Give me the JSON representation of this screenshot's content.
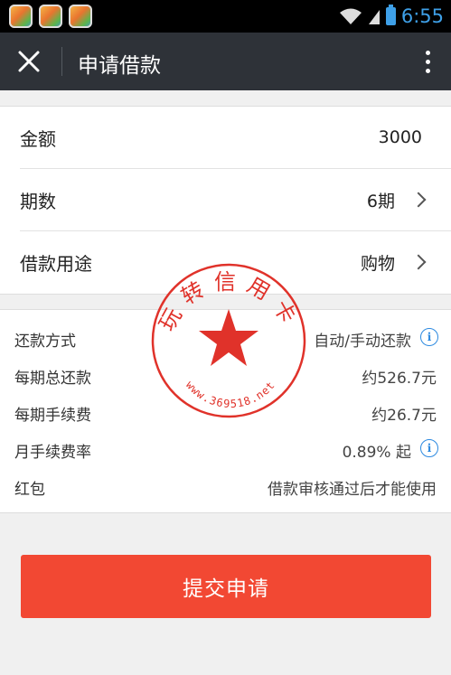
{
  "statusbar": {
    "time": "6:55"
  },
  "titlebar": {
    "title": "申请借款"
  },
  "form": {
    "amount": {
      "label": "金额",
      "value": "3000"
    },
    "periods": {
      "label": "期数",
      "value": "6期"
    },
    "purpose": {
      "label": "借款用途",
      "value": "购物"
    }
  },
  "details": [
    {
      "label": "还款方式",
      "value": "自动/手动还款"
    },
    {
      "label": "每期总还款",
      "value": "约526.7元"
    },
    {
      "label": "每期手续费",
      "value": "约26.7元"
    },
    {
      "label": "月手续费率",
      "value": "0.89% 起"
    },
    {
      "label": "红包",
      "value": "借款审核通过后才能使用"
    }
  ],
  "submit_label": "提交申请",
  "watermark": {
    "text": "玩转信用卡",
    "url": "www.369518.net"
  },
  "colors": {
    "accent": "#f24833",
    "info": "#2d8ae0",
    "titlebar": "#2e3238"
  }
}
